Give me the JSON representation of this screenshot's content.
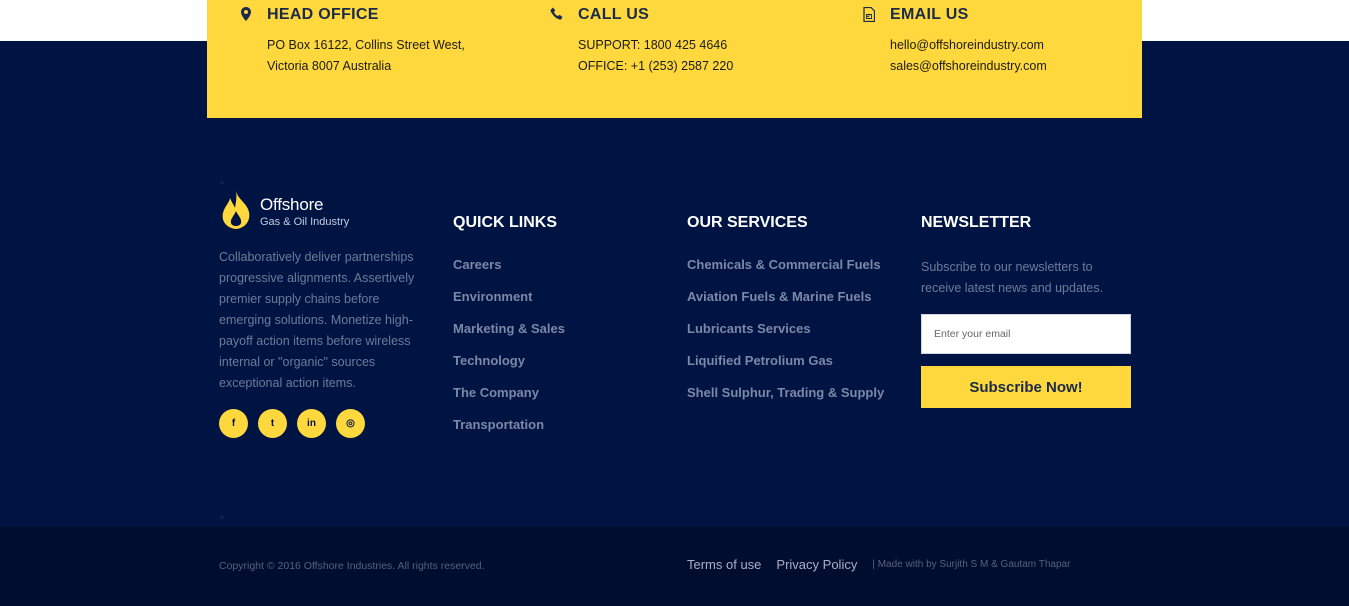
{
  "contact": {
    "head_office": {
      "title": "HEAD OFFICE",
      "line1": "PO Box 16122, Collins Street West,",
      "line2": "Victoria 8007 Australia",
      "icon": "map-pin-icon"
    },
    "call_us": {
      "title": "CALL US",
      "line1": "SUPPORT: 1800 425 4646",
      "line2": "OFFICE: +1 (253) 2587 220",
      "icon": "phone-icon"
    },
    "email_us": {
      "title": "EMAIL US",
      "line1": "hello@offshoreindustry.com",
      "line2": "sales@offshoreindustry.com",
      "icon": "email-file-icon"
    }
  },
  "brand": {
    "name": "Offshore",
    "tagline": "Gas & Oil Industry",
    "about": "Collaboratively deliver partnerships progressive alignments. Assertively premier supply chains before emerging solutions. Monetize high-payoff action items before wireless internal or \"organic\" sources exceptional action items."
  },
  "socials": [
    {
      "glyph": "f",
      "icon": "facebook-icon"
    },
    {
      "glyph": "t",
      "icon": "twitter-icon"
    },
    {
      "glyph": "in",
      "icon": "linkedin-icon"
    },
    {
      "glyph": "◎",
      "icon": "instagram-icon"
    }
  ],
  "quick_links": {
    "title": "QUICK LINKS",
    "items": [
      "Careers",
      "Environment",
      "Marketing & Sales",
      "Technology",
      "The Company",
      "Transportation"
    ]
  },
  "services": {
    "title": "OUR SERVICES",
    "items": [
      "Chemicals & Commercial Fuels",
      "Aviation Fuels & Marine Fuels",
      "Lubricants Services",
      "Liquified Petrolium Gas",
      "Shell Sulphur, Trading & Supply"
    ]
  },
  "newsletter": {
    "title": "NEWSLETTER",
    "text": "Subscribe to our newsletters to receive latest news and updates.",
    "placeholder": "Enter your email",
    "button": "Subscribe Now!"
  },
  "bottom": {
    "copyright": "Copyright © 2016 Offshore Industries. All rights reserved.",
    "terms": "Terms of use",
    "privacy": "Privacy Policy",
    "made_by": "| Made with  by Surjith S M & Gautam Thapar"
  },
  "stray_marks": [
    ">",
    ">"
  ],
  "colors": {
    "accent": "#ffd83d",
    "footer_bg": "#001443",
    "bottom_bg": "#000d2e"
  }
}
